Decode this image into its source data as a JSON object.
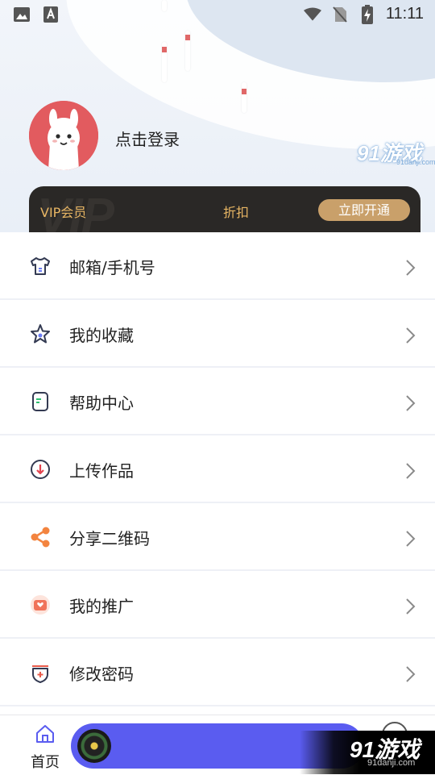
{
  "status_bar": {
    "left_icons": [
      "image-icon",
      "font-a-icon"
    ],
    "right_icons": [
      "wifi-icon",
      "no-sim-icon",
      "battery-charging-icon"
    ],
    "time": "11:11"
  },
  "profile": {
    "avatar": "alpaca-avatar",
    "login_text": "点击登录"
  },
  "watermark": {
    "logo": "91游戏",
    "site": "91danji.com"
  },
  "vip": {
    "background_text": "VIP",
    "label": "VIP会员",
    "discount": "折扣",
    "button": "立即开通",
    "accent_color": "#e8b664",
    "button_color": "#c9a06a"
  },
  "menu": {
    "items": [
      {
        "label": "邮箱/手机号",
        "icon": "shirt-icon"
      },
      {
        "label": "我的收藏",
        "icon": "star-icon"
      },
      {
        "label": "帮助中心",
        "icon": "document-icon"
      },
      {
        "label": "上传作品",
        "icon": "download-circle-icon"
      },
      {
        "label": "分享二维码",
        "icon": "share-icon"
      },
      {
        "label": "我的推广",
        "icon": "promotion-icon"
      },
      {
        "label": "修改密码",
        "icon": "shield-plus-icon"
      }
    ]
  },
  "tabbar": {
    "home_label": "首页",
    "player_color": "#5a5cf0"
  }
}
